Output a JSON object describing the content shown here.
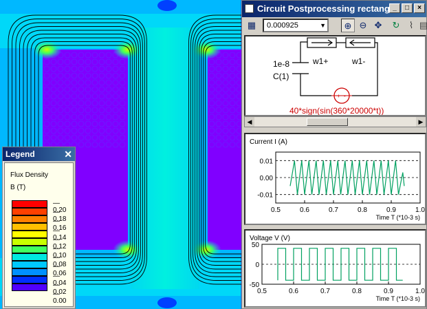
{
  "field_view": {
    "palette": [
      "#7a00ff",
      "#5000ff",
      "#0030ff",
      "#0090ff",
      "#00c8ff",
      "#00e8e0",
      "#40ff60",
      "#c8ff00",
      "#ffff00",
      "#ffc000",
      "#ff8000",
      "#ff4000",
      "#ff0000"
    ]
  },
  "legend": {
    "title": "Legend",
    "close_label": "✕",
    "quantity": "Flux Density",
    "unit": "B (T)",
    "levels": [
      "0.20",
      "0.18",
      "0.16",
      "0.14",
      "0.12",
      "0.10",
      "0.08",
      "0.06",
      "0.04",
      "0.02",
      "0.00"
    ]
  },
  "circuit_window": {
    "title": "Circuit Postprocessing rectang...",
    "time_value": "0.000925",
    "circuit": {
      "capacitor_value": "1e-8",
      "capacitor_name": "C(1)",
      "coil_plus": "w1+",
      "coil_minus": "w1-",
      "source_expr": "40*sign(sin(360*20000*t))",
      "source_color": "#cc0000"
    }
  },
  "chart_data": [
    {
      "type": "line",
      "title": "Current I (A)",
      "xlabel": "Time T (*10-3 s)",
      "xlim": [
        0.5,
        1.0
      ],
      "ylim": [
        -0.015,
        0.015
      ],
      "x_ticks": [
        "0.5",
        "0.6",
        "0.7",
        "0.8",
        "0.9",
        "1.0"
      ],
      "y_ticks": [
        "0.01",
        "0.00",
        "-0.01"
      ],
      "color": "#00a060",
      "series": [
        {
          "x": [
            0.55,
            0.565,
            0.575,
            0.59,
            0.6,
            0.615,
            0.625,
            0.64,
            0.65,
            0.665,
            0.675,
            0.69,
            0.7,
            0.715,
            0.725,
            0.74,
            0.75,
            0.765,
            0.775,
            0.79,
            0.8,
            0.815,
            0.825,
            0.84,
            0.85,
            0.865,
            0.875,
            0.89,
            0.9,
            0.915,
            0.925,
            0.94,
            0.945
          ],
          "y": [
            -0.005,
            0.01,
            -0.01,
            0.01,
            -0.01,
            0.01,
            -0.01,
            0.01,
            -0.01,
            0.01,
            -0.01,
            0.01,
            -0.01,
            0.01,
            -0.01,
            0.01,
            -0.01,
            0.01,
            -0.01,
            0.01,
            -0.01,
            0.01,
            -0.01,
            0.01,
            -0.01,
            0.01,
            -0.01,
            0.01,
            -0.01,
            0.01,
            -0.01,
            0.003,
            -0.005
          ]
        }
      ]
    },
    {
      "type": "line",
      "title": "Voltage V (V)",
      "xlabel": "Time T (*10-3 s)",
      "xlim": [
        0.5,
        1.0
      ],
      "ylim": [
        -50,
        50
      ],
      "x_ticks": [
        "0.5",
        "0.6",
        "0.7",
        "0.8",
        "0.9",
        "1.0"
      ],
      "y_ticks": [
        "50",
        "0",
        "-50"
      ],
      "color": "#00a060",
      "series": [
        {
          "x": [
            0.55,
            0.55,
            0.575,
            0.575,
            0.6,
            0.6,
            0.625,
            0.625,
            0.65,
            0.65,
            0.675,
            0.675,
            0.7,
            0.7,
            0.725,
            0.725,
            0.75,
            0.75,
            0.775,
            0.775,
            0.8,
            0.8,
            0.825,
            0.825,
            0.85,
            0.85,
            0.875,
            0.875,
            0.9,
            0.9,
            0.925,
            0.925,
            0.945
          ],
          "y": [
            -40,
            40,
            40,
            -40,
            -40,
            40,
            40,
            -40,
            -40,
            40,
            40,
            -40,
            -40,
            40,
            40,
            -40,
            -40,
            40,
            40,
            -40,
            -40,
            40,
            40,
            -40,
            -40,
            40,
            40,
            -40,
            -40,
            40,
            40,
            -40,
            -40
          ]
        }
      ]
    }
  ]
}
